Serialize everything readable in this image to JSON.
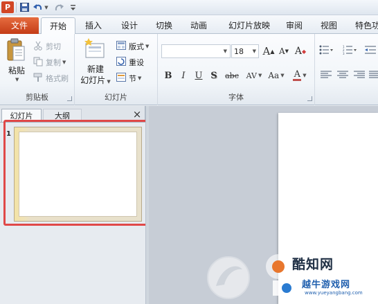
{
  "qat": {
    "app_icon": "P",
    "save_icon": "save-icon",
    "undo_icon": "undo-icon",
    "redo_icon": "redo-icon",
    "customize_icon": "customize-qat-icon"
  },
  "tabs": [
    {
      "label": "文件"
    },
    {
      "label": "开始"
    },
    {
      "label": "插入"
    },
    {
      "label": "设计"
    },
    {
      "label": "切换"
    },
    {
      "label": "动画"
    },
    {
      "label": "幻灯片放映"
    },
    {
      "label": "审阅"
    },
    {
      "label": "视图"
    },
    {
      "label": "特色功"
    }
  ],
  "clipboard": {
    "paste": "粘贴",
    "cut": "剪切",
    "copy": "复制",
    "format_painter": "格式刷",
    "label": "剪贴板"
  },
  "slides_group": {
    "new_slide_line1": "新建",
    "new_slide_line2": "幻灯片",
    "layout": "版式",
    "reset": "重设",
    "section": "节",
    "label": "幻灯片"
  },
  "font": {
    "size": "18",
    "grow": "A",
    "shrink": "A",
    "clear": "A",
    "bold": "B",
    "italic": "I",
    "underline": "U",
    "shadow": "S",
    "strike": "abc",
    "spacing": "AV",
    "case": "Aa",
    "color": "A",
    "label": "字体"
  },
  "panel": {
    "tab_slides": "幻灯片",
    "tab_outline": "大纲",
    "close": "×",
    "slide_number": "1"
  },
  "watermark": {
    "brand": "酷知网",
    "site_cn": "越牛游戏网",
    "site_url": "www.yueyangbang.com"
  },
  "colors": {
    "file_tab": "#d24726",
    "highlight": "#e04848"
  }
}
